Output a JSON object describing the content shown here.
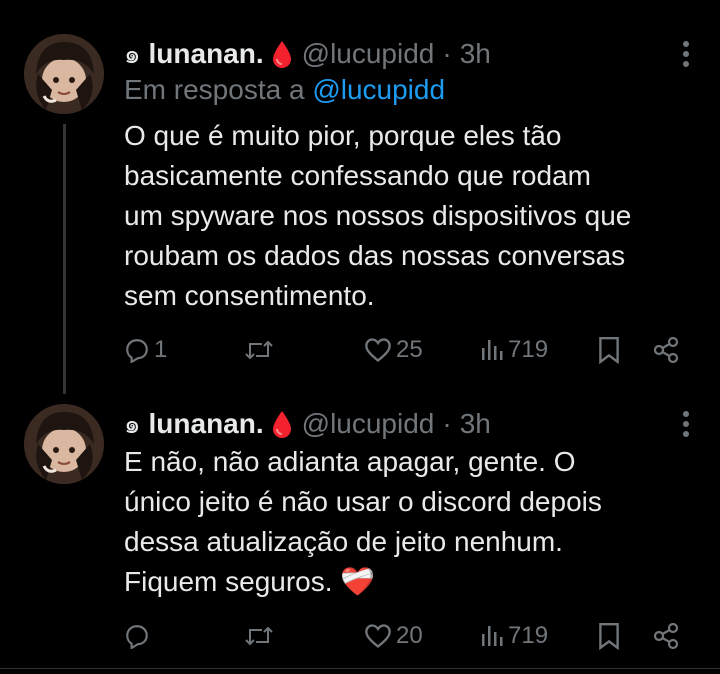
{
  "tweets": [
    {
      "name": "lunanan.",
      "handle": "@lucupidd",
      "dot": "·",
      "time": "3h",
      "reply_to_prefix": "Em resposta a",
      "reply_to_handle": "@lucupidd",
      "text": "O que é muito pior, porque eles tão\nbasicamente confessando que rodam\num spyware nos nossos dispositivos que\nroubam os dados das nossas conversas\nsem consentimento.",
      "replies": "1",
      "reposts": "",
      "likes": "25",
      "views": "719"
    },
    {
      "name": "lunanan.",
      "handle": "@lucupidd",
      "dot": "·",
      "time": "3h",
      "text": "E não, não adianta apagar, gente. O\núnico jeito é não usar o discord depois\ndessa atualização de jeito nenhum.\nFiquem seguros.",
      "emoji": "❤️‍🩹",
      "replies": "",
      "reposts": "",
      "likes": "20",
      "views": "719"
    }
  ],
  "colors": {
    "background": "#000000",
    "text": "#e7e9ea",
    "muted": "#71767b",
    "link": "#1d9bf0",
    "drop": "#f4212e"
  },
  "icons": [
    "spiral-icon",
    "blood-drop-icon",
    "more-icon",
    "reply-icon",
    "repost-icon",
    "like-icon",
    "views-icon",
    "bookmark-icon",
    "share-icon",
    "mending-heart-icon"
  ]
}
